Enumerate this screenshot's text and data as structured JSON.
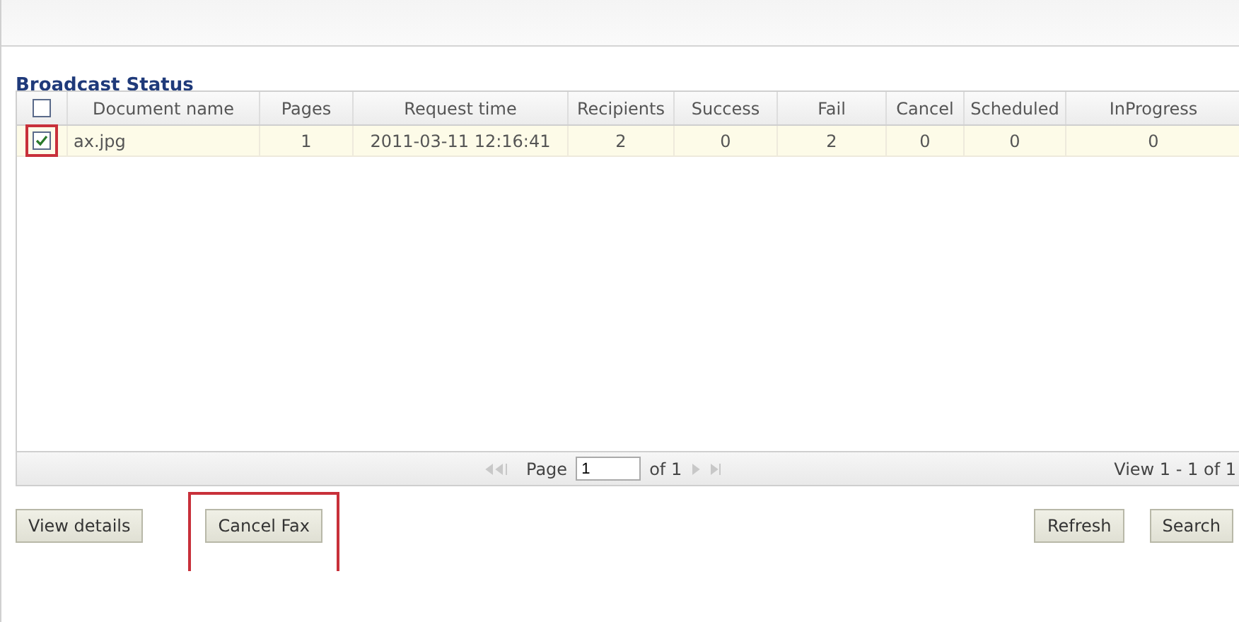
{
  "title": "Broadcast Status",
  "table": {
    "select_all": {
      "checked": false
    },
    "columns": [
      "Document name",
      "Pages",
      "Request time",
      "Recipients",
      "Success",
      "Fail",
      "Cancel",
      "Scheduled",
      "InProgress"
    ],
    "rows": [
      {
        "checked": true,
        "highlighted": true,
        "cells": [
          "ax.jpg",
          "1",
          "2011-03-11 12:16:41",
          "2",
          "0",
          "2",
          "0",
          "0",
          "0"
        ]
      }
    ]
  },
  "pager": {
    "page_label": "Page",
    "page_value": "1",
    "of_label": "of 1",
    "view_text": "View 1 - 1 of 1"
  },
  "buttons": [
    {
      "label": "View details",
      "highlighted": false
    },
    {
      "label": "Cancel Fax",
      "highlighted": true
    }
  ],
  "right_buttons": [
    {
      "label": "Refresh"
    },
    {
      "label": "Search"
    }
  ]
}
